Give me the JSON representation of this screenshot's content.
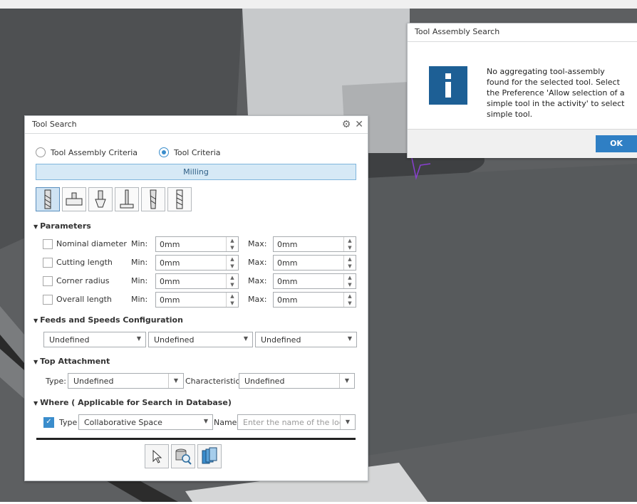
{
  "tool_search": {
    "title": "Tool Search",
    "radio_assembly": "Tool Assembly Criteria",
    "radio_tool": "Tool Criteria",
    "category": "Milling",
    "parameters_title": "Parameters",
    "params": [
      {
        "label": "Nominal diameter",
        "min_label": "Min:",
        "min": "0mm",
        "max_label": "Max:",
        "max": "0mm"
      },
      {
        "label": "Cutting length",
        "min_label": "Min:",
        "min": "0mm",
        "max_label": "Max:",
        "max": "0mm"
      },
      {
        "label": "Corner radius",
        "min_label": "Min:",
        "min": "0mm",
        "max_label": "Max:",
        "max": "0mm"
      },
      {
        "label": "Overall length",
        "min_label": "Min:",
        "min": "0mm",
        "max_label": "Max:",
        "max": "0mm"
      }
    ],
    "feeds_title": "Feeds and Speeds Configuration",
    "feeds": [
      "Undefined",
      "Undefined",
      "Undefined"
    ],
    "top_attachment_title": "Top Attachment",
    "type_label": "Type:",
    "type_value": "Undefined",
    "characteristic_label": "Characteristic:",
    "characteristic_value": "Undefined",
    "where_title": "Where ( Applicable for Search in Database)",
    "where_type_label": "Type",
    "where_type_value": "Collaborative Space",
    "name_label": "Name",
    "name_placeholder": "Enter the name of the loca"
  },
  "info_dialog": {
    "title": "Tool Assembly Search",
    "message": "No aggregating tool-assembly found for the selected tool. Select the Preference 'Allow selection of a simple tool in the activity' to select simple tool.",
    "ok": "OK"
  },
  "colors": {
    "accent": "#3a8dcc",
    "info_icon": "#1d5f95",
    "ok_button": "#2f7fc4"
  }
}
